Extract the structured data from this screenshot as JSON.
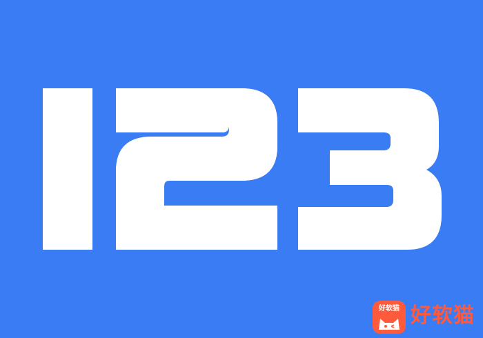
{
  "logo": {
    "text": "123",
    "background_color": "#3a7cf4",
    "glyph_color": "#ffffff"
  },
  "watermark": {
    "badge_text": "好软猫",
    "text": "好软猫",
    "color": "#ff5a3c",
    "icon": "cat-face-icon"
  }
}
